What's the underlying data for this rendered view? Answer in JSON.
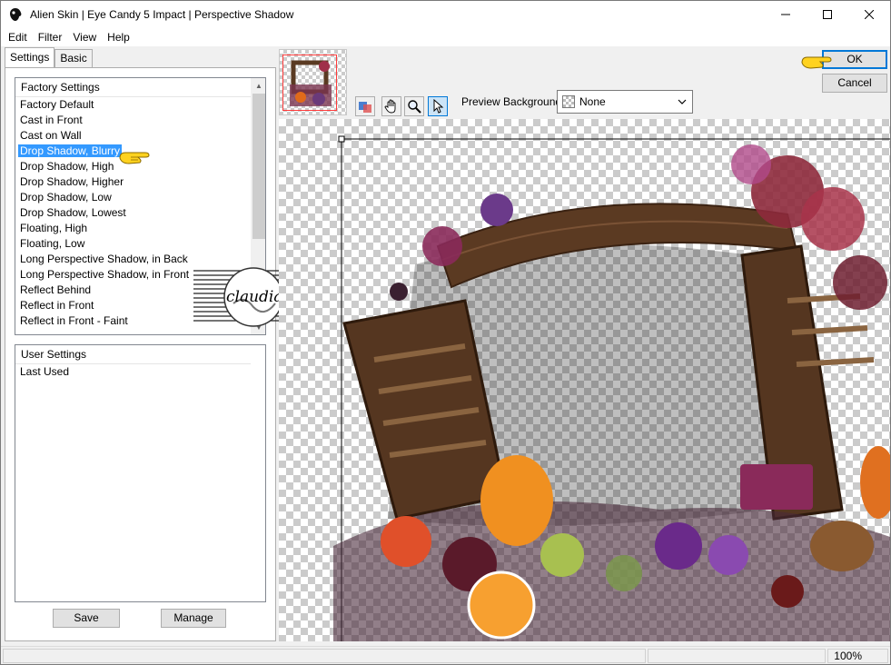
{
  "window": {
    "title": "Alien Skin | Eye Candy 5 Impact | Perspective Shadow"
  },
  "menu": [
    "Edit",
    "Filter",
    "View",
    "Help"
  ],
  "tabs": [
    "Settings",
    "Basic"
  ],
  "factory_settings": {
    "header": "Factory Settings",
    "items": [
      "Factory Default",
      "Cast in Front",
      "Cast on Wall",
      "Drop Shadow, Blurry",
      "Drop Shadow, High",
      "Drop Shadow, Higher",
      "Drop Shadow, Low",
      "Drop Shadow, Lowest",
      "Floating, High",
      "Floating, Low",
      "Long Perspective Shadow, in Back",
      "Long Perspective Shadow, in Front",
      "Reflect Behind",
      "Reflect in Front",
      "Reflect in Front - Faint"
    ],
    "selected": "Drop Shadow, Blurry"
  },
  "user_settings": {
    "header": "User Settings",
    "items": [
      "Last Used"
    ]
  },
  "buttons": {
    "save": "Save",
    "manage": "Manage",
    "ok": "OK",
    "cancel": "Cancel"
  },
  "preview": {
    "label": "Preview Background:",
    "value": "None"
  },
  "watermark": {
    "text": "claudia"
  },
  "status": {
    "zoom": "100%"
  },
  "colors": {
    "accent": "#0078d7",
    "selection": "#3399ff"
  }
}
